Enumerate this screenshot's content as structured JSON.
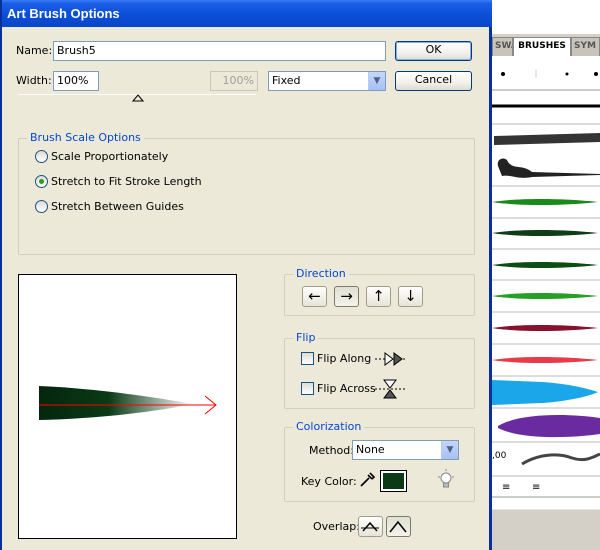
{
  "window": {
    "title": "Art Brush Options"
  },
  "name_row": {
    "label": "Name:",
    "value": "Brush5"
  },
  "width_row": {
    "label": "Width:",
    "value": "100%",
    "disabled_value": "100%",
    "mode": "Fixed"
  },
  "buttons": {
    "ok": "OK",
    "cancel": "Cancel"
  },
  "brush_scale": {
    "title": "Brush Scale Options",
    "options": [
      "Scale Proportionately",
      "Stretch to Fit Stroke Length",
      "Stretch Between Guides"
    ],
    "selected": 1
  },
  "direction": {
    "title": "Direction",
    "arrows": [
      "←",
      "→",
      "↑",
      "↓"
    ],
    "selected": 1
  },
  "flip": {
    "title": "Flip",
    "along": "Flip Along",
    "across": "Flip Across"
  },
  "colorization": {
    "title": "Colorization",
    "method_label": "Method:",
    "method_value": "None",
    "key_color_label": "Key Color:",
    "key_color": "#0a3a16"
  },
  "overlap": {
    "label": "Overlap:"
  },
  "brushes_panel": {
    "tabs": [
      "SWA",
      "BRUSHES",
      "SYM"
    ],
    "readout": ",00",
    "strokes": [
      {
        "color": "#000000"
      },
      {
        "color": "#1a1a1a"
      },
      {
        "color": "#111111"
      },
      {
        "color": "#1a8a1a"
      },
      {
        "color": "#0e3d18"
      },
      {
        "color": "#0b4d12"
      },
      {
        "color": "#25a025"
      },
      {
        "color": "#8a1030"
      },
      {
        "color": "#e83a48"
      },
      {
        "color": "#1aa6e8"
      },
      {
        "color": "#6a2aa0"
      }
    ]
  },
  "colors": {
    "title_bar": "#0b4ed8",
    "group_title": "#0046d5",
    "preview_arrow": "#ff0000"
  }
}
